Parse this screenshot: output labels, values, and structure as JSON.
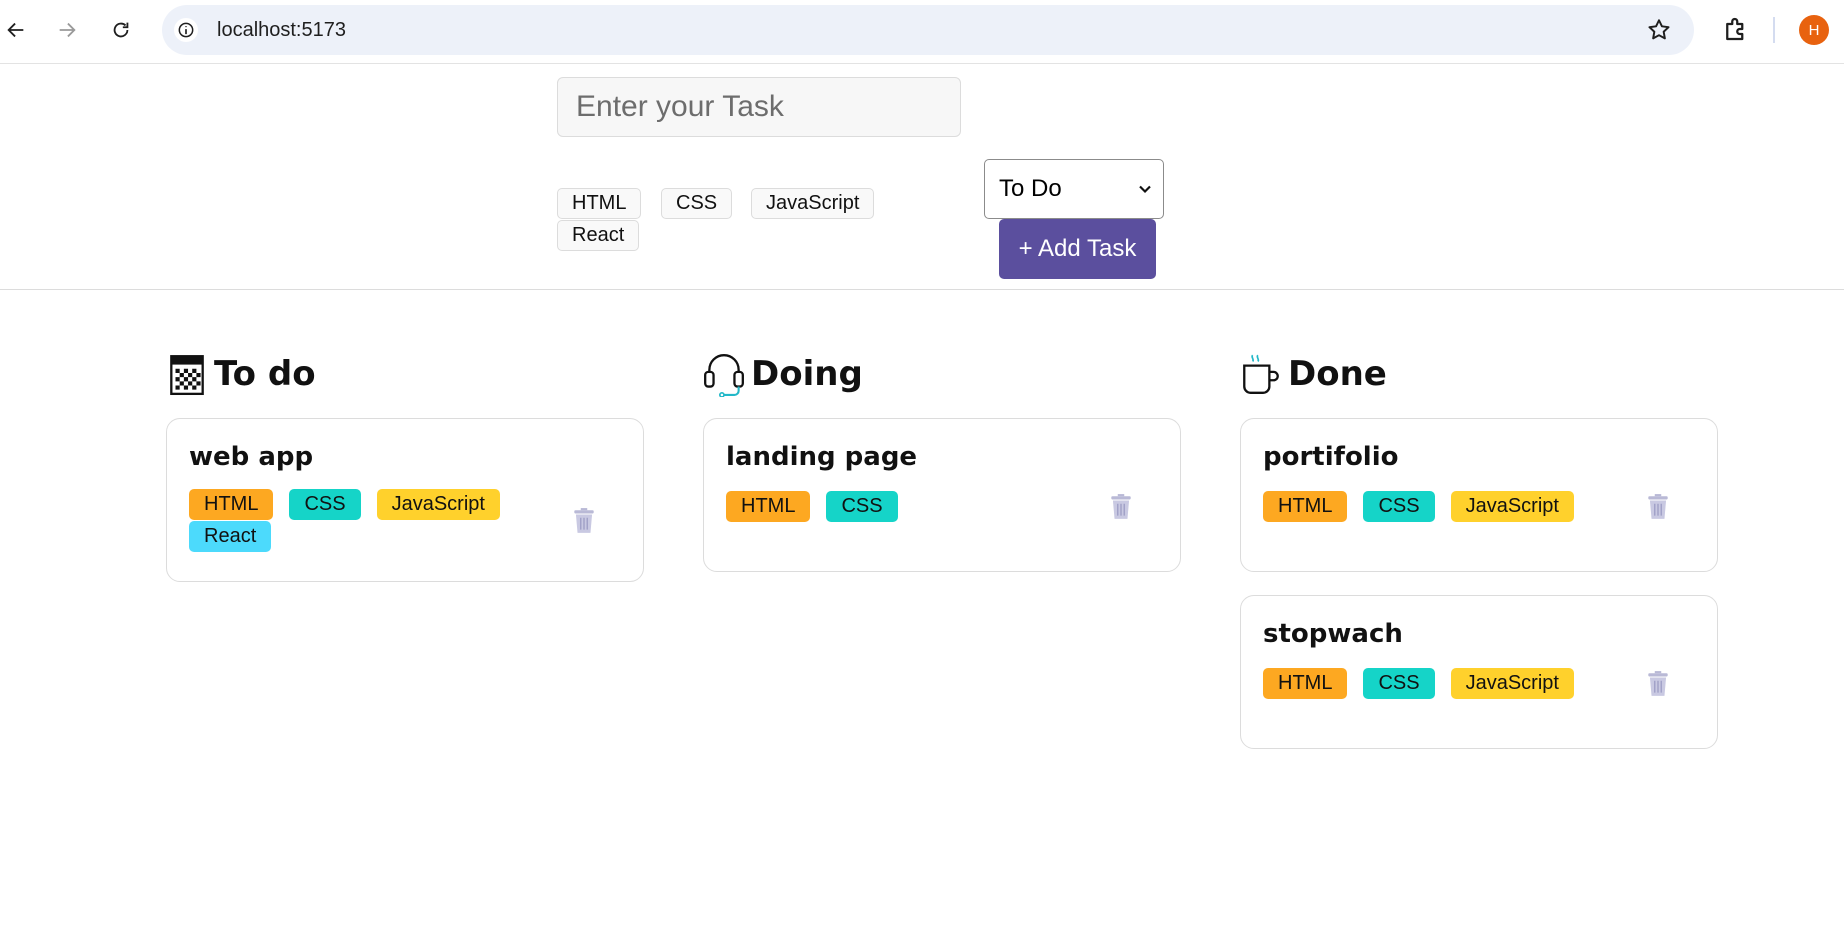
{
  "browser": {
    "url": "localhost:5173",
    "avatar_letter": "H",
    "colors": {
      "omnibox": "#edf1f9",
      "avatar": "#e8620f"
    }
  },
  "form": {
    "task_placeholder": "Enter your Task",
    "tags": [
      "HTML",
      "CSS",
      "JavaScript",
      "React"
    ],
    "status_selected": "To Do",
    "add_button_label": "+ Add Task",
    "add_button_color": "#5b4f9e"
  },
  "tag_colors": {
    "HTML": "#fda821",
    "CSS": "#15d4c8",
    "JavaScript": "#ffd12c",
    "React": "#4cdafc"
  },
  "columns": [
    {
      "title": "To do",
      "icon": "checklist-icon",
      "cards": [
        {
          "title": "web app",
          "tags": [
            "HTML",
            "CSS",
            "JavaScript",
            "React"
          ]
        }
      ]
    },
    {
      "title": "Doing",
      "icon": "headset-icon",
      "cards": [
        {
          "title": "landing page",
          "tags": [
            "HTML",
            "CSS"
          ]
        }
      ]
    },
    {
      "title": "Done",
      "icon": "coffee-icon",
      "cards": [
        {
          "title": "portifolio",
          "tags": [
            "HTML",
            "CSS",
            "JavaScript"
          ]
        },
        {
          "title": "stopwach",
          "tags": [
            "HTML",
            "CSS",
            "JavaScript"
          ]
        }
      ]
    }
  ]
}
